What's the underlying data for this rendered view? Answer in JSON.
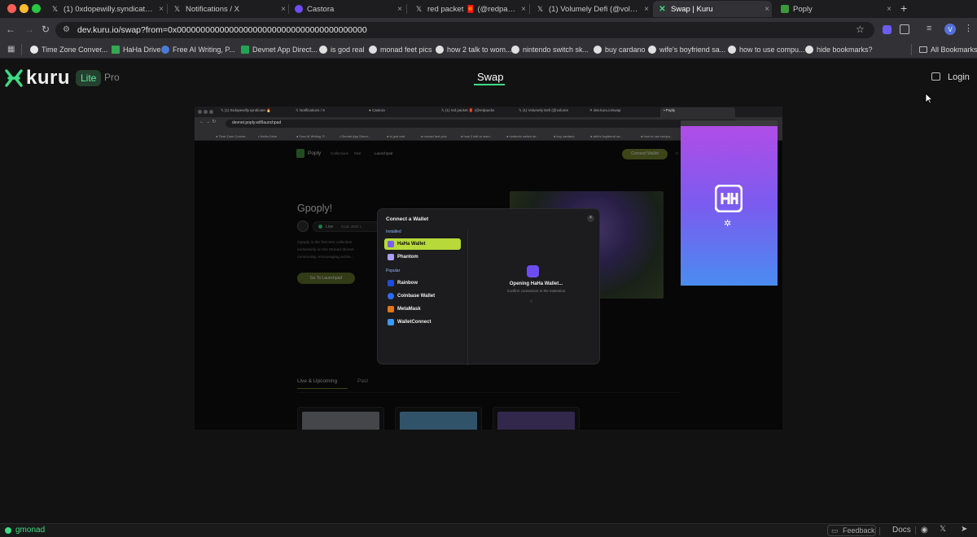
{
  "browser": {
    "tabs": [
      {
        "label": "(1) 0xdopewilly.syndicate 🔥",
        "icon": "x-icon"
      },
      {
        "label": "Notifications / X",
        "icon": "x-icon"
      },
      {
        "label": "Castora",
        "icon": "castora-icon"
      },
      {
        "label": "red packet 🧧 (@redpacke",
        "icon": "x-icon"
      },
      {
        "label": "(1) Volumely Defi (@volumely",
        "icon": "x-icon"
      },
      {
        "label": "Swap | Kuru",
        "icon": "kuru-icon"
      },
      {
        "label": "Poply",
        "icon": "poply-icon"
      }
    ],
    "new_tab": "+",
    "url": "dev.kuru.io/swap?from=0x0000000000000000000000000000000000000000",
    "bookmarks": [
      {
        "label": "Time Zone Conver...",
        "color": "#e9e9e9"
      },
      {
        "label": "HaHa Drive",
        "color": "#34a853"
      },
      {
        "label": "Free AI Writing, P...",
        "color": "#4a7bd8"
      },
      {
        "label": "Devnet App Direct...",
        "color": "#23a455"
      },
      {
        "label": "is god real",
        "color": "#e0e0e0"
      },
      {
        "label": "monad feet pics",
        "color": "#e0e0e0"
      },
      {
        "label": "how 2 talk to wom...",
        "color": "#e0e0e0"
      },
      {
        "label": "nintendo switch sk...",
        "color": "#e0e0e0"
      },
      {
        "label": "buy cardano",
        "color": "#e0e0e0"
      },
      {
        "label": "wife's boyfriend sa...",
        "color": "#e0e0e0"
      },
      {
        "label": "how to use compu...",
        "color": "#e0e0e0"
      },
      {
        "label": "hide bookmarks?",
        "color": "#e0e0e0"
      }
    ],
    "all_bookmarks": "All Bookmarks",
    "avatar_letter": "V"
  },
  "app": {
    "logo_text": "kuru",
    "mode_lite": "Lite",
    "mode_pro": "Pro",
    "nav_swap": "Swap",
    "login": "Login",
    "accent": "#3ddc84"
  },
  "statusbar": {
    "network": "gmonad",
    "feedback": "Feedback",
    "docs": "Docs"
  },
  "inner": {
    "url": "devnet.poply.wtf/launchpad",
    "brand": "Poply",
    "nav": [
      "Collections",
      "Mint",
      "Launchpad"
    ],
    "connect_btn": "Connect Wallet",
    "heading": "Gpoply!",
    "live_badge": "Live",
    "ends_text": "Ends 3500 t...",
    "desc": [
      "Gpoply is the first test collection",
      "exclusively on the Monad devnet",
      "community, encouraging active..."
    ],
    "launch_btn": "Go To Launchpad",
    "tab_live": "Live & Upcoming",
    "tab_past": "Past",
    "modal": {
      "title": "Connect a Wallet",
      "installed": "Installed",
      "popular": "Popular",
      "wallets_installed": [
        {
          "name": "HaHa Wallet",
          "color": "#7b5cf0"
        },
        {
          "name": "Phantom",
          "color": "#ab9ff2"
        }
      ],
      "wallets_popular": [
        {
          "name": "Rainbow",
          "color": "#1f4bd8"
        },
        {
          "name": "Coinbase Wallet",
          "color": "#2d6cf6"
        },
        {
          "name": "MetaMask",
          "color": "#e2761b"
        },
        {
          "name": "WalletConnect",
          "color": "#3b99fc"
        }
      ],
      "opening": "Opening HaHa Wallet...",
      "confirm": "Confirm connection in the extension"
    },
    "popup_title": "HaHa"
  }
}
